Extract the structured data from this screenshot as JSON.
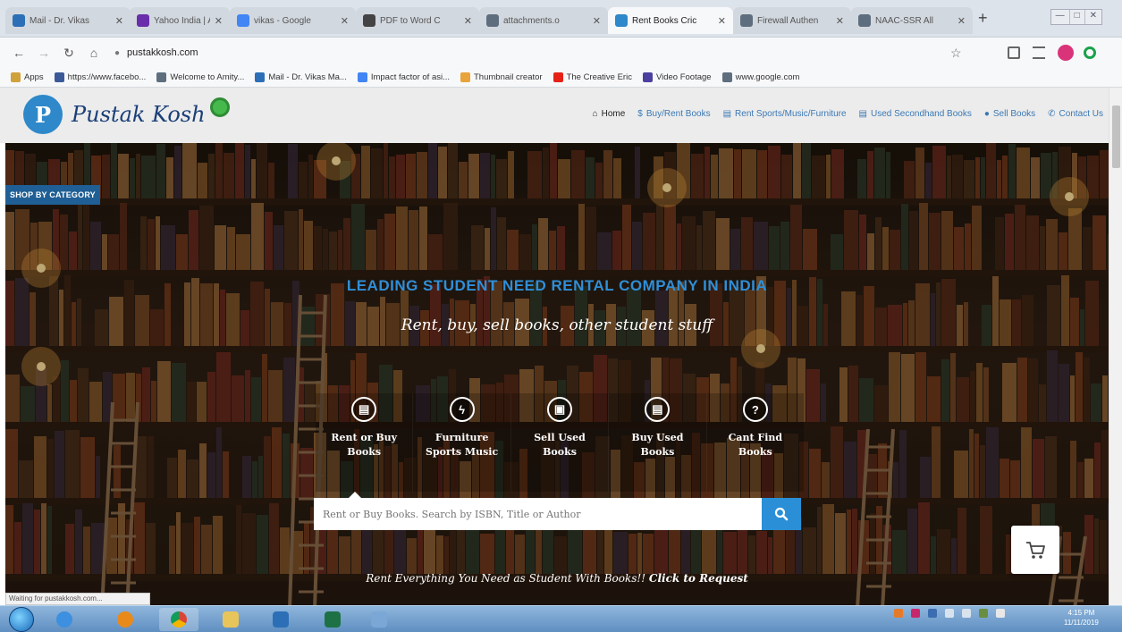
{
  "browser": {
    "tabs": [
      {
        "title": "Mail - Dr. Vikas",
        "color": "#2c6fb7"
      },
      {
        "title": "Yahoo India | A",
        "color": "#6a2eaa"
      },
      {
        "title": "vikas - Google",
        "color": "#4285f4"
      },
      {
        "title": "PDF to Word C",
        "color": "#444444"
      },
      {
        "title": "attachments.o",
        "color": "#5f6e7e"
      },
      {
        "title": "Rent Books Cric",
        "color": "#2e88c9"
      },
      {
        "title": "Firewall Authen",
        "color": "#5f6e7e"
      },
      {
        "title": "NAAC-SSR All",
        "color": "#5f6e7e"
      }
    ],
    "new_tab": "+",
    "url": "pustakkosh.com",
    "bookmarks": [
      {
        "label": "Apps",
        "color": "#d0a23a"
      },
      {
        "label": "https://www.facebo...",
        "color": "#3b5998"
      },
      {
        "label": "Welcome to Amity...",
        "color": "#5f6e7e"
      },
      {
        "label": "Mail - Dr. Vikas Ma...",
        "color": "#2c6fb7"
      },
      {
        "label": "Impact factor of asi...",
        "color": "#4285f4"
      },
      {
        "label": "Thumbnail creator",
        "color": "#e8a33a"
      },
      {
        "label": "The Creative Eric",
        "color": "#e62117"
      },
      {
        "label": "Video Footage",
        "color": "#4b3fa0"
      },
      {
        "label": "www.google.com",
        "color": "#5f6e7e"
      }
    ],
    "status_text": "Waiting for pustakkosh.com..."
  },
  "site": {
    "logo_text": "Pustak Kosh",
    "logo_letter": "P",
    "nav": [
      {
        "label": "Home",
        "icon": "home-icon"
      },
      {
        "label": "Buy/Rent Books",
        "icon": "dollar-icon"
      },
      {
        "label": "Rent Sports/Music/Furniture",
        "icon": "list-icon"
      },
      {
        "label": "Used Secondhand Books",
        "icon": "list-icon"
      },
      {
        "label": "Sell Books",
        "icon": "book-icon"
      },
      {
        "label": "Contact Us",
        "icon": "phone-icon"
      }
    ],
    "shop_by_category": "SHOP BY CATEGORY",
    "headline": "LEADING STUDENT NEED RENTAL COMPANY IN INDIA",
    "subheadline": "Rent, buy, sell books, other student stuff",
    "categories": [
      {
        "label": "Rent or Buy\nBooks",
        "glyph": "▤"
      },
      {
        "label": "Furniture\nSports Music",
        "glyph": "ϟ"
      },
      {
        "label": "Sell Used\nBooks",
        "glyph": "▣"
      },
      {
        "label": "Buy Used\nBooks",
        "glyph": "▤"
      },
      {
        "label": "Cant Find\nBooks",
        "glyph": "?"
      }
    ],
    "search_placeholder": "Rent or Buy Books. Search by ISBN, Title or Author",
    "bottom_text": "Rent Everything You Need as Student With Books!!",
    "bottom_link": "Click to Request",
    "accent": "#2a8fd6"
  },
  "taskbar": {
    "clock_time": "4:15 PM",
    "clock_date": "11/11/2019"
  }
}
